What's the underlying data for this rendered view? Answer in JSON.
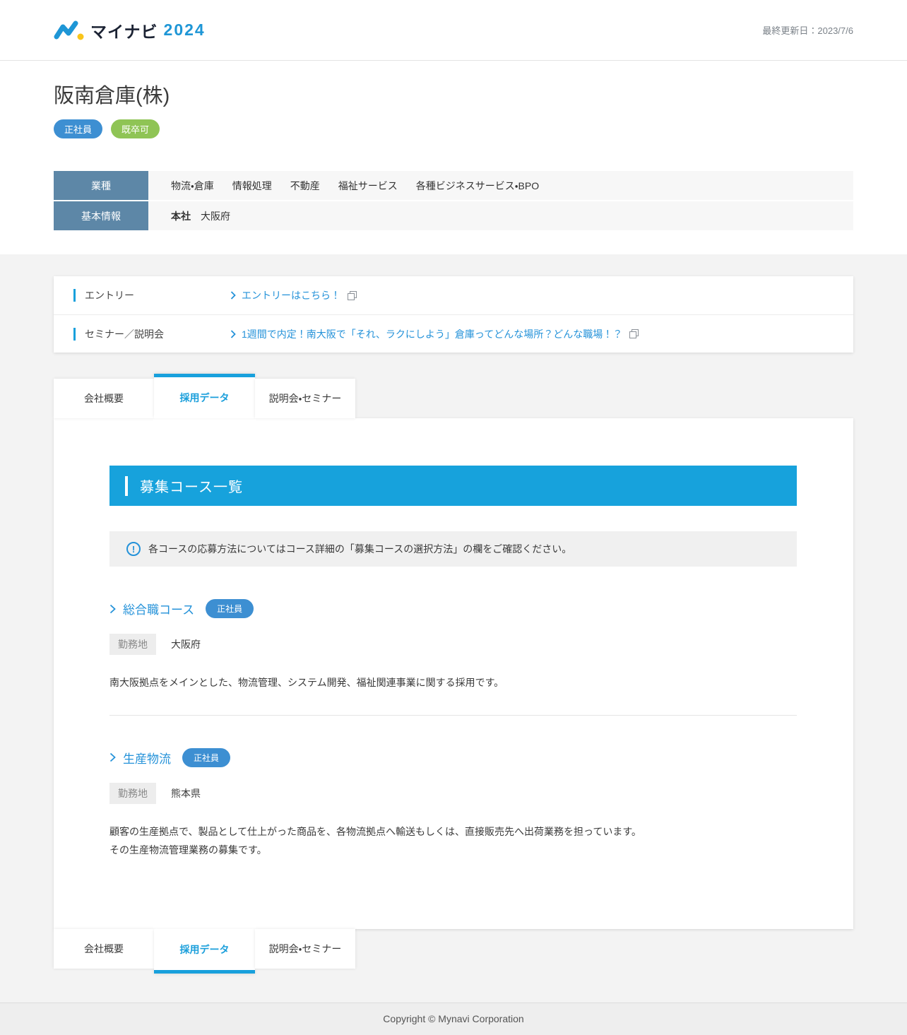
{
  "header": {
    "logo_brand": "マイナビ",
    "logo_year": "2024",
    "last_updated": "最終更新日：2023/7/6"
  },
  "company": {
    "name": "阪南倉庫(株)",
    "badges": [
      {
        "label": "正社員"
      },
      {
        "label": "既卒可"
      }
    ],
    "info_rows": [
      {
        "header": "業種",
        "items": [
          "物流・倉庫",
          "情報処理",
          "不動産",
          "福祉サービス",
          "各種ビジネスサービス・BPO"
        ]
      },
      {
        "header": "基本情報",
        "label": "本社",
        "value": "大阪府"
      }
    ]
  },
  "entry": {
    "rows": [
      {
        "label": "エントリー",
        "link": "エントリーはこちら！"
      },
      {
        "label": "セミナー／説明会",
        "link": "1週間で内定！南大阪で「それ、ラクにしよう」倉庫ってどんな場所？どんな職場！？"
      }
    ]
  },
  "tabs": [
    {
      "label": "会社概要"
    },
    {
      "label": "採用データ"
    },
    {
      "label": "説明会・セミナー"
    }
  ],
  "content": {
    "section_title": "募集コース一覧",
    "notice": "各コースの応募方法についてはコース詳細の「募集コースの選択方法」の欄をご確認ください。",
    "courses": [
      {
        "title": "総合職コース",
        "badge": "正社員",
        "location_label": "勤務地",
        "location": "大阪府",
        "lines": [
          "南大阪拠点をメインとした、物流管理、システム開発、福祉関連事業に関する採用です。"
        ]
      },
      {
        "title": "生産物流",
        "badge": "正社員",
        "location_label": "勤務地",
        "location": "熊本県",
        "lines": [
          "顧客の生産拠点で、製品として仕上がった商品を、各物流拠点へ輸送もしくは、直接販売先へ出荷業務を担っています。",
          "その生産物流管理業務の募集です。"
        ]
      }
    ]
  },
  "footer": {
    "copyright": "Copyright © Mynavi Corporation"
  },
  "colors": {
    "accent_cyan": "#18a0dc",
    "link_blue": "#2492d9",
    "table_header_blue": "#5d87a7",
    "badge_blue": "#3d8fd2",
    "badge_green": "#8fc455",
    "banner_blue": "#17a2dc",
    "logo_blue": "#1e96d6",
    "logo_dot_yellow": "#f9c51b"
  }
}
